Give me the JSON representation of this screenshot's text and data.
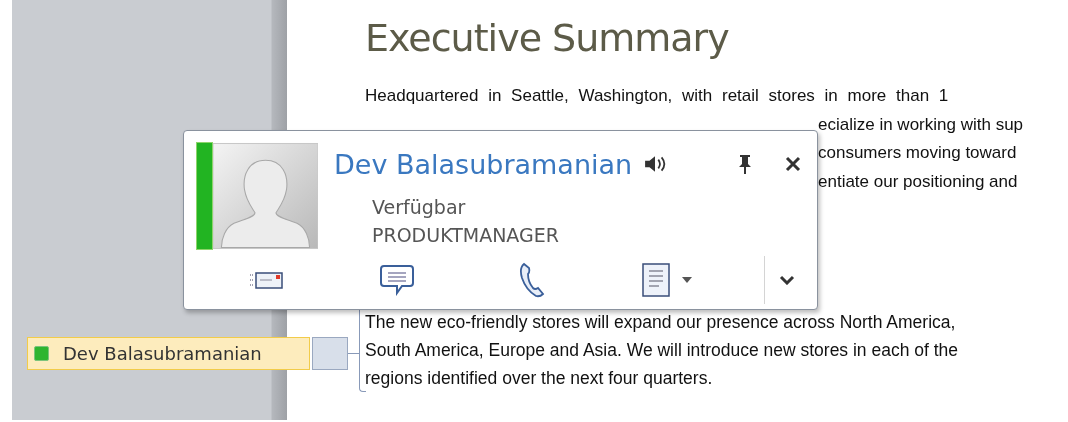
{
  "document": {
    "title": "Executive Summary",
    "lines": [
      "Headquartered in Seattle, Washington, with retail stores in more than 1",
      "ecialize in working with sup",
      "consumers moving toward",
      "entiate our positioning and"
    ],
    "comment": "The new eco-friendly stores will expand our presence across North America, South America, Europe and Asia. We will introduce new stores in each of the regions identified over the next four quarters."
  },
  "author_tag": {
    "name": "Dev Balasubramanian"
  },
  "contact_card": {
    "name": "Dev Balasubramanian",
    "status": "Verfügbar",
    "title": "PRODUKTMANAGER"
  }
}
